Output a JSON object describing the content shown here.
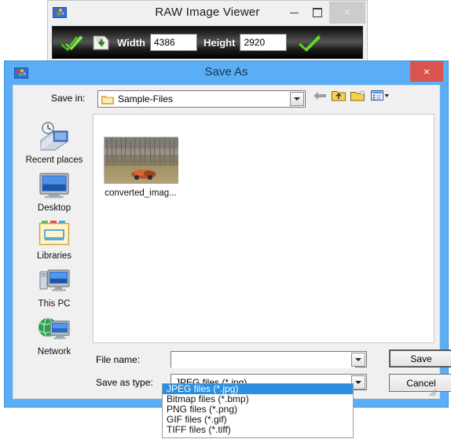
{
  "raw_viewer": {
    "title": "RAW Image Viewer",
    "app_icon": "image-app-icon",
    "window_buttons": {
      "minimize": "minimize-icon",
      "maximize": "maximize-icon",
      "close": "close-icon"
    },
    "toolbar": {
      "check_icon": "green-double-check-icon",
      "save_icon": "save-to-disk-icon",
      "width_label": "Width",
      "width_value": "4386",
      "height_label": "Height",
      "height_value": "2920",
      "apply_icon": "green-check-icon"
    }
  },
  "save_dialog": {
    "title": "Save As",
    "app_icon": "image-app-icon",
    "close_label": "×",
    "save_in": {
      "label": "Save in:",
      "value": "Sample-Files",
      "folder_icon": "folder-icon",
      "dropdown_icon": "chevron-down-icon"
    },
    "nav_icons": [
      {
        "name": "back-arrow-icon"
      },
      {
        "name": "up-one-level-icon"
      },
      {
        "name": "new-folder-icon"
      },
      {
        "name": "views-icon"
      }
    ],
    "places": [
      {
        "label": "Recent places",
        "icon": "recent-places-icon"
      },
      {
        "label": "Desktop",
        "icon": "desktop-icon"
      },
      {
        "label": "Libraries",
        "icon": "libraries-icon"
      },
      {
        "label": "This PC",
        "icon": "this-pc-icon"
      },
      {
        "label": "Network",
        "icon": "network-icon"
      }
    ],
    "files": [
      {
        "name": "converted_imag...",
        "thumbnail": "forest-field-photo-thumbnail"
      }
    ],
    "file_name": {
      "label": "File name:",
      "value": "",
      "placeholder": ""
    },
    "save_as_type": {
      "label": "Save as type:",
      "value": "JPEG files (*.jpg)",
      "options": [
        "JPEG files (*.jpg)",
        "Bitmap files (*.bmp)",
        "PNG files (*.png)",
        "GIF files (*.gif)",
        "TIFF files (*.tiff)"
      ],
      "selected_index": 0,
      "expanded": true
    },
    "buttons": {
      "save": "Save",
      "cancel": "Cancel"
    },
    "resize_grip": "resize-grip-icon"
  },
  "colors": {
    "dialog_border": "#5aaef5",
    "close_red": "#d9534f",
    "highlight_blue": "#2a8fe0",
    "dialog_face": "#f0f0f0"
  }
}
